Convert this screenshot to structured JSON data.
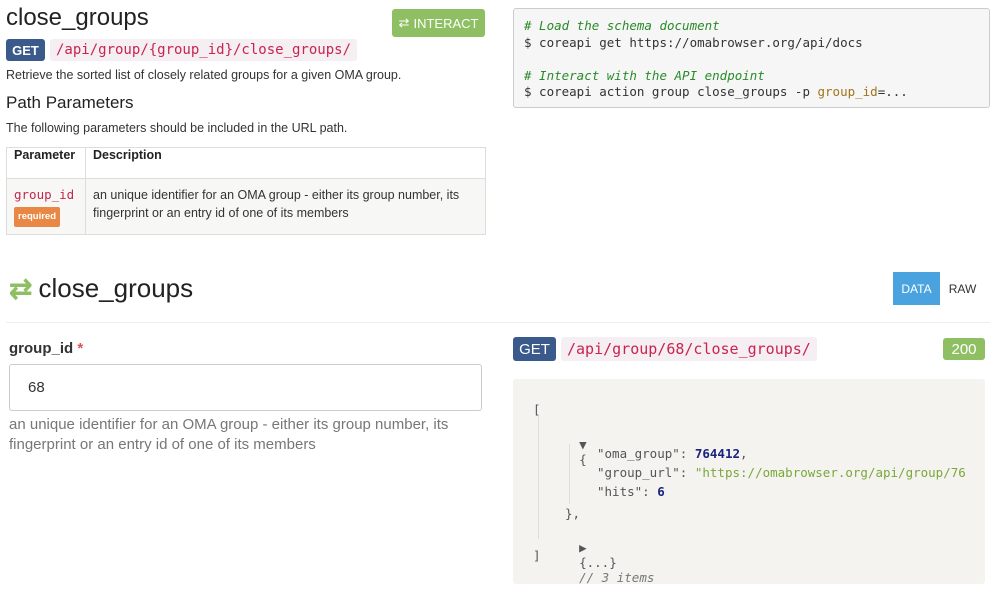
{
  "doc": {
    "title": "close_groups",
    "interact_label": "INTERACT",
    "method": "GET",
    "url": "/api/group/{group_id}/close_groups/",
    "description": "Retrieve the sorted list of closely related groups for a given OMA group.",
    "path_params_heading": "Path Parameters",
    "path_params_sub": "The following parameters should be included in the URL path.",
    "table": {
      "headers": [
        "Parameter",
        "Description"
      ],
      "rows": [
        {
          "name": "group_id",
          "badge": "required",
          "description": "an unique identifier for an OMA group - either its group number, its fingerprint or an entry id of one of its members"
        }
      ]
    }
  },
  "code_sample": {
    "comment1": "# Load the schema document",
    "line1": "$ coreapi get https://omabrowser.org/api/docs",
    "comment2": "# Interact with the API endpoint",
    "line2_prefix": "$ coreapi action group close_groups -p ",
    "line2_param": "group_id",
    "line2_suffix": "=..."
  },
  "interact": {
    "title": "close_groups",
    "tabs": {
      "data": "DATA",
      "raw": "RAW"
    },
    "field": {
      "label": "group_id",
      "required_mark": "*",
      "value": "68",
      "help": "an unique identifier for an OMA group - either its group number, its fingerprint or an entry id of one of its members"
    },
    "request": {
      "method": "GET",
      "url": "/api/group/68/close_groups/",
      "status": "200"
    },
    "response": {
      "open_bracket": "[",
      "obj_open": "{",
      "key1": "\"oma_group\"",
      "val1": "764412",
      "key2": "\"group_url\"",
      "val2": "\"https://omabrowser.org/api/group/76",
      "key3": "\"hits\"",
      "val3": "6",
      "obj_close": "},",
      "collapsed": "{...}",
      "collapsed_comment": "// 3 items",
      "close_bracket": "]"
    }
  }
}
